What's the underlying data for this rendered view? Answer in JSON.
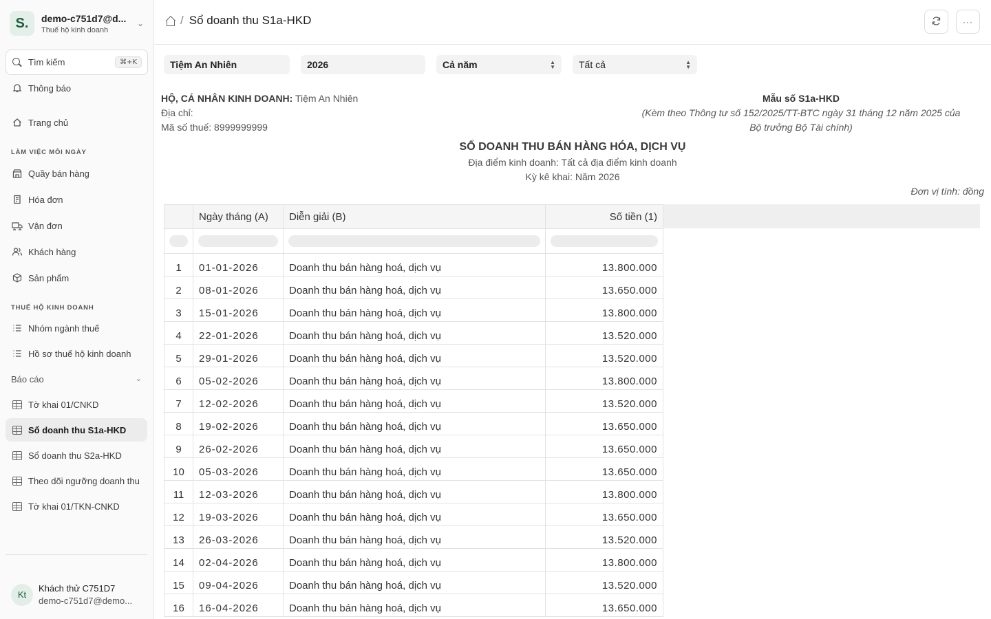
{
  "workspace": {
    "initial": "S.",
    "name": "demo-c751d7@d...",
    "subtitle": "Thuế hộ kinh doanh"
  },
  "search": {
    "label": "Tìm kiếm",
    "shortcut": "⌘+K"
  },
  "nav": {
    "notifications": "Thông báo",
    "home": "Trang chủ",
    "section_daily": "LÀM VIỆC MỖI NGÀY",
    "daily": [
      "Quầy bán hàng",
      "Hóa đơn",
      "Vận đơn",
      "Khách hàng",
      "Sản phẩm"
    ],
    "section_tax": "THUẾ HỘ KINH DOANH",
    "tax": [
      "Nhóm ngành thuế",
      "Hồ sơ thuế hộ kinh doanh"
    ],
    "reports_group": "Báo cáo",
    "reports": [
      "Tờ khai 01/CNKD",
      "Sổ doanh thu S1a-HKD",
      "Sổ doanh thu S2a-HKD",
      "Theo dõi ngưỡng doanh thu",
      "Tờ khai 01/TKN-CNKD"
    ]
  },
  "user": {
    "initials": "Kt",
    "name": "Khách thử C751D7",
    "email": "demo-c751d7@demo..."
  },
  "breadcrumb": {
    "separator": "/",
    "title": "Sổ doanh thu S1a-HKD"
  },
  "filters": {
    "shop": "Tiệm An Nhiên",
    "year": "2026",
    "period": "Cả năm",
    "location": "Tất cả"
  },
  "header": {
    "owner_label": "HỘ, CÁ NHÂN KINH DOANH:",
    "owner_value": "Tiệm An Nhiên",
    "address_label": "Địa chỉ:",
    "tax_code": "Mã số thuế: 8999999999",
    "form_code": "Mẫu số S1a-HKD",
    "form_note_1": "(Kèm theo Thông tư số 152/2025/TT-BTC ngày 31 tháng 12 năm 2025 của",
    "form_note_2": "Bộ trưởng Bộ Tài chính)"
  },
  "report": {
    "title": "SỔ DOANH THU BÁN HÀNG HÓA, DỊCH VỤ",
    "location": "Địa điểm kinh doanh: Tất cả địa điểm kinh doanh",
    "period": "Kỳ kê khai: Năm 2026",
    "unit": "Đơn vị tính: đồng"
  },
  "table": {
    "columns": [
      "",
      "Ngày tháng (A)",
      "Diễn giải (B)",
      "Số tiền (1)"
    ],
    "rows": [
      [
        "1",
        "01-01-2026",
        "Doanh thu bán hàng hoá, dịch vụ",
        "13.800.000"
      ],
      [
        "2",
        "08-01-2026",
        "Doanh thu bán hàng hoá, dịch vụ",
        "13.650.000"
      ],
      [
        "3",
        "15-01-2026",
        "Doanh thu bán hàng hoá, dịch vụ",
        "13.800.000"
      ],
      [
        "4",
        "22-01-2026",
        "Doanh thu bán hàng hoá, dịch vụ",
        "13.520.000"
      ],
      [
        "5",
        "29-01-2026",
        "Doanh thu bán hàng hoá, dịch vụ",
        "13.520.000"
      ],
      [
        "6",
        "05-02-2026",
        "Doanh thu bán hàng hoá, dịch vụ",
        "13.800.000"
      ],
      [
        "7",
        "12-02-2026",
        "Doanh thu bán hàng hoá, dịch vụ",
        "13.520.000"
      ],
      [
        "8",
        "19-02-2026",
        "Doanh thu bán hàng hoá, dịch vụ",
        "13.650.000"
      ],
      [
        "9",
        "26-02-2026",
        "Doanh thu bán hàng hoá, dịch vụ",
        "13.650.000"
      ],
      [
        "10",
        "05-03-2026",
        "Doanh thu bán hàng hoá, dịch vụ",
        "13.650.000"
      ],
      [
        "11",
        "12-03-2026",
        "Doanh thu bán hàng hoá, dịch vụ",
        "13.800.000"
      ],
      [
        "12",
        "19-03-2026",
        "Doanh thu bán hàng hoá, dịch vụ",
        "13.650.000"
      ],
      [
        "13",
        "26-03-2026",
        "Doanh thu bán hàng hoá, dịch vụ",
        "13.520.000"
      ],
      [
        "14",
        "02-04-2026",
        "Doanh thu bán hàng hoá, dịch vụ",
        "13.800.000"
      ],
      [
        "15",
        "09-04-2026",
        "Doanh thu bán hàng hoá, dịch vụ",
        "13.520.000"
      ],
      [
        "16",
        "16-04-2026",
        "Doanh thu bán hàng hoá, dịch vụ",
        "13.650.000"
      ]
    ]
  },
  "icons": {
    "search": "search-icon",
    "bell": "bell-icon",
    "home": "home-icon",
    "store": "store-icon",
    "invoice": "invoice-icon",
    "truck": "truck-icon",
    "users": "users-icon",
    "box": "box-icon",
    "list": "list-icon",
    "table": "table-icon",
    "refresh": "refresh-icon",
    "more": "more-icon"
  },
  "colors": {
    "brand": "#1d5c3c",
    "brand_bg": "#e5efe9",
    "active_bg": "#ececec"
  }
}
